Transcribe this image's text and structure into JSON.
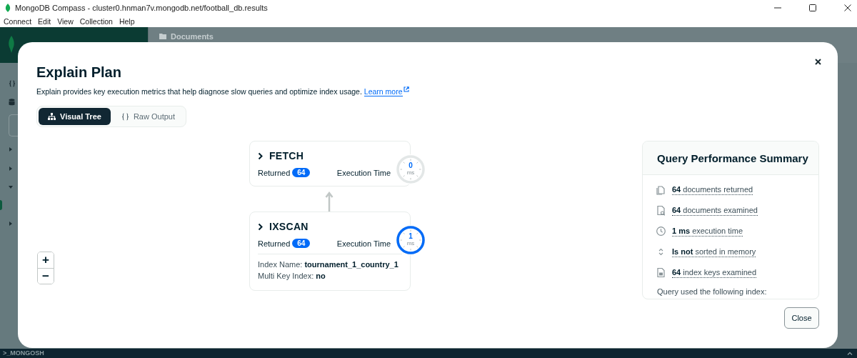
{
  "window": {
    "title": "MongoDB Compass - cluster0.hnman7v.mongodb.net/football_db.results"
  },
  "menu": [
    "Connect",
    "Edit",
    "View",
    "Collection",
    "Help"
  ],
  "background": {
    "tab_label": "Documents",
    "shell_label": ">_MONGOSH"
  },
  "modal": {
    "title": "Explain Plan",
    "description": "Explain provides key execution metrics that help diagnose slow queries and optimize index usage.",
    "link": "Learn more",
    "view_toggle": [
      {
        "label": "Visual Tree",
        "kind": "tree",
        "selected": true
      },
      {
        "label": "Raw Output",
        "kind": "braces",
        "selected": false
      }
    ],
    "stages": [
      {
        "name": "FETCH",
        "returned_label": "Returned",
        "returned": "64",
        "time_label": "Execution Time",
        "time": "0",
        "time_unit": "ms",
        "level": 0
      },
      {
        "name": "IXSCAN",
        "returned_label": "Returned",
        "returned": "64",
        "time_label": "Execution Time",
        "time": "1",
        "time_unit": "ms",
        "level": 1,
        "details": [
          {
            "label": "Index Name:",
            "value": "tournament_1_country_1"
          },
          {
            "label": "Multi Key Index:",
            "value": "no"
          }
        ]
      }
    ],
    "zoom_controls": [
      "+",
      "−"
    ],
    "summary": {
      "title": "Query Performance Summary",
      "items": [
        {
          "kind": "documents",
          "text": "**64** documents returned"
        },
        {
          "kind": "examined",
          "text": "**64** documents examined"
        },
        {
          "kind": "time",
          "text": "**1 ms** execution time"
        },
        {
          "kind": "sort",
          "text": "**Is not** sorted in memory"
        },
        {
          "kind": "keys",
          "text": "**64** index keys examined"
        }
      ],
      "footer": "Query used the following index:"
    },
    "close_button": "Close"
  }
}
